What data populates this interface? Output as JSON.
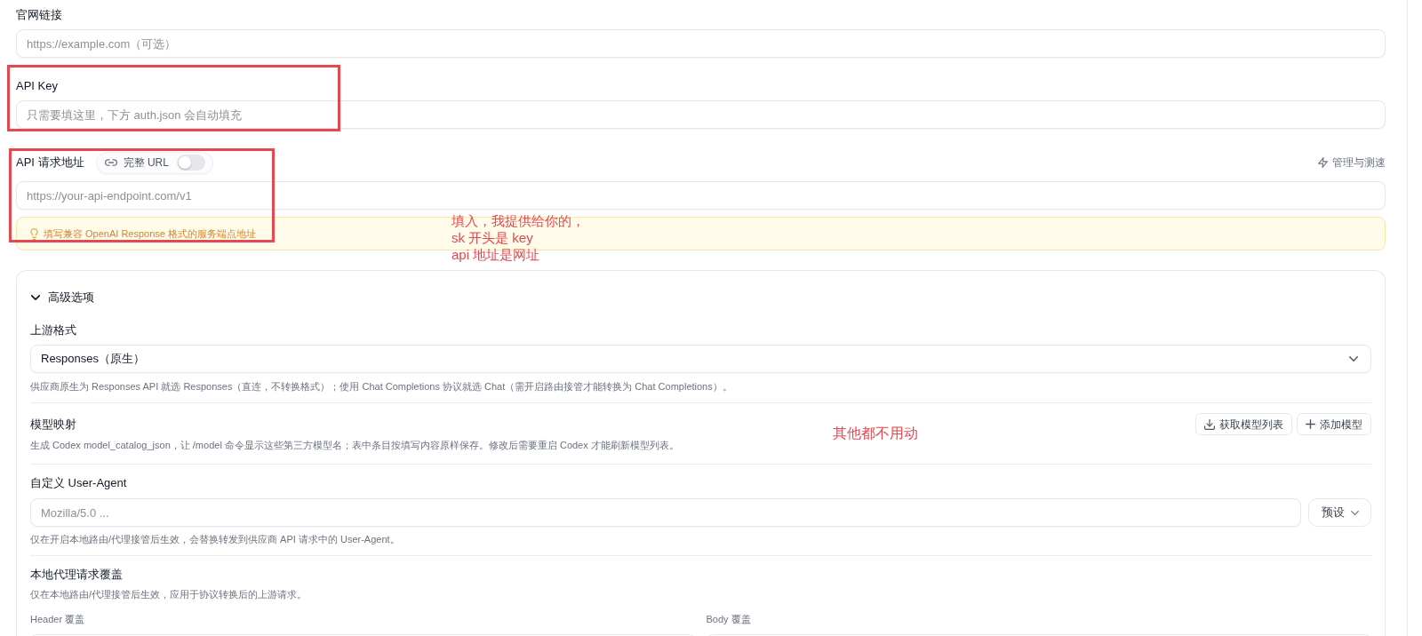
{
  "fields": [
    {
      "kind": "text",
      "label": "官网链接",
      "placeholder": "https://example.com（可选）",
      "annotated": false
    },
    {
      "kind": "text",
      "label": "API Key",
      "placeholder": "只需要填这里，下方 auth.json 会自动填充",
      "annotated": true
    },
    {
      "kind": "endpoint",
      "label": "API 请求地址",
      "toggle": {
        "label": "完整 URL",
        "on": false
      },
      "action": "管理与测速",
      "placeholder": "https://your-api-endpoint.com/v1",
      "hint": "填写兼容 OpenAI Response 格式的服务端点地址",
      "annotated": true,
      "note_lines": [
        "填入，我提供给你的，",
        "sk 开头是 key",
        "api 地址是网址"
      ]
    }
  ],
  "advanced": {
    "title": "高级选项",
    "expanded": true,
    "sections": [
      {
        "kind": "select",
        "label": "上游格式",
        "value": "Responses（原生）",
        "help": "供应商原生为 Responses API 就选 Responses（直连，不转换格式）；使用 Chat Completions 协议就选 Chat（需开启路由接管才能转换为 Chat Completions）。"
      },
      {
        "kind": "list",
        "label": "模型映射",
        "buttons": [
          {
            "kind": "fetch",
            "label": "获取模型列表"
          },
          {
            "kind": "add",
            "label": "添加模型"
          }
        ],
        "help": "生成 Codex model_catalog_json，让 /model 命令显示这些第三方模型名；表中条目按填写内容原样保存。修改后需要重启 Codex 才能刷新模型列表。",
        "note": "其他都不用动"
      },
      {
        "kind": "input",
        "label": "自定义 User-Agent",
        "placeholder": "Mozilla/5.0 ...",
        "preset": "预设",
        "help": "仅在开启本地路由/代理接管后生效，会替换转发到供应商 API 请求中的 User-Agent。"
      },
      {
        "kind": "overrides",
        "label": "本地代理请求覆盖",
        "help": "仅在本地路由/代理接管后生效，应用于协议转换后的上游请求。",
        "editors": [
          {
            "label": "Header 覆盖"
          },
          {
            "label": "Body 覆盖"
          }
        ]
      }
    ]
  }
}
